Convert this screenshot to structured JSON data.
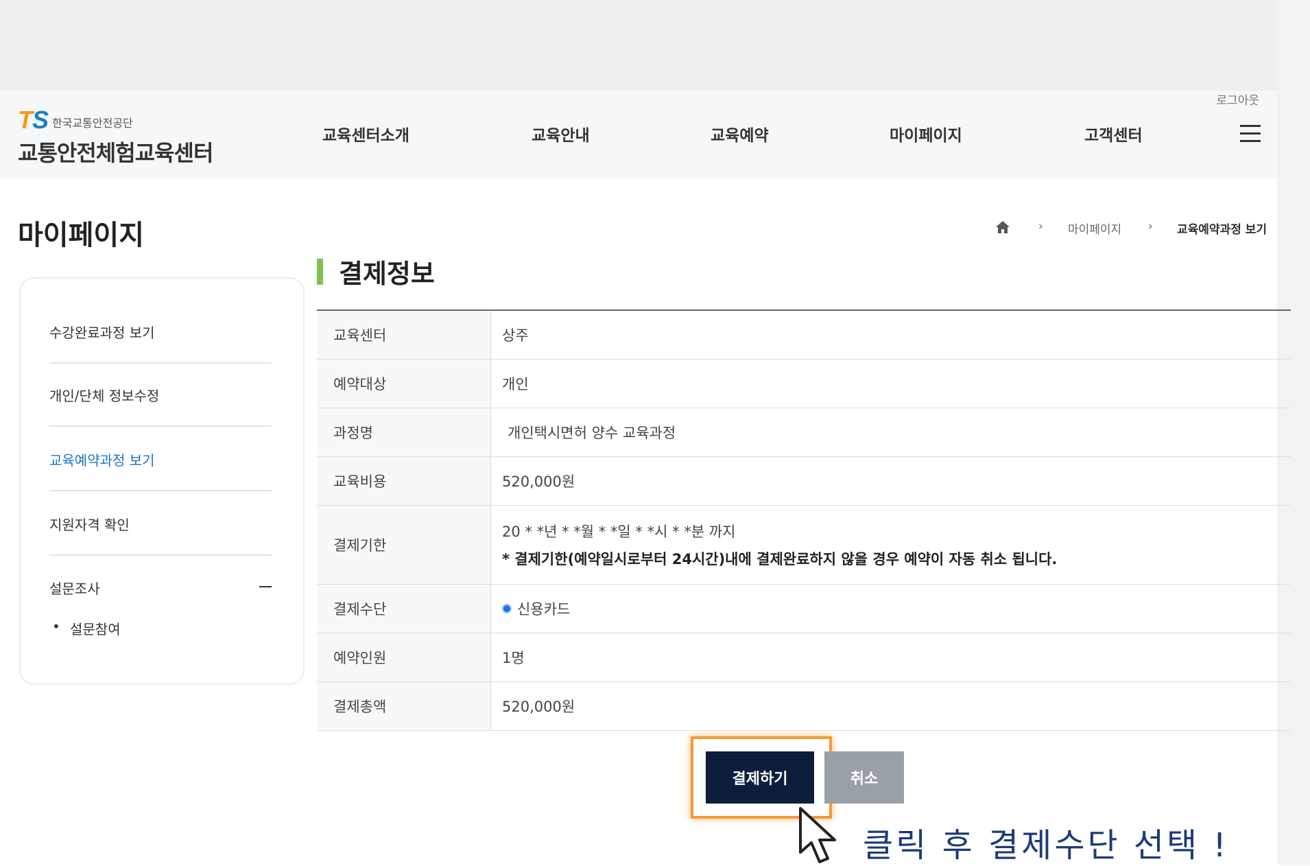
{
  "header": {
    "logout": "로그아웃",
    "logo_ts": "TS",
    "logo_sub": "한국교통안전공단",
    "logo_main": "교통안전체험교육센터",
    "nav": [
      "교육센터소개",
      "교육안내",
      "교육예약",
      "마이페이지",
      "고객센터"
    ],
    "menu_icon": "hamburger-icon"
  },
  "page": {
    "title": "마이페이지",
    "breadcrumb": [
      "마이페이지",
      "교육예약과정 보기"
    ]
  },
  "sidebar": {
    "items": [
      "수강완료과정 보기",
      "개인/단체 정보수정",
      "교육예약과정 보기",
      "지원자격 확인",
      "설문조사"
    ],
    "active": "교육예약과정 보기",
    "sub_items": [
      "설문참여"
    ]
  },
  "section": {
    "title": "결제정보"
  },
  "table": {
    "rows": [
      {
        "label": "교육센터",
        "value": "상주"
      },
      {
        "label": "예약대상",
        "value": "개인"
      },
      {
        "label": "과정명",
        "value": "개인택시면허 양수 교육과정"
      },
      {
        "label": "교육비용",
        "value": "520,000원"
      },
      {
        "label": "결제기한",
        "value": "20 * *년 * *월 * *일 * *시 * *분 까지",
        "note": "* 결제기한(예약일시로부터 24시간)내에 결제완료하지 않을 경우 예약이 자동 취소 됩니다."
      },
      {
        "label": "결제수단",
        "value": "신용카드"
      },
      {
        "label": "예약인원",
        "value": "1명"
      },
      {
        "label": "결제총액",
        "value": "520,000원"
      }
    ]
  },
  "buttons": {
    "pay": "결제하기",
    "cancel": "취소"
  },
  "hint": "클릭 후 결제수단 선택 !",
  "colors": {
    "accent_green": "#7cc24e",
    "active_blue": "#1a73c8",
    "pay_button": "#0d1e3d",
    "highlight_orange": "#f39a35",
    "hint_text": "#1c3b75"
  }
}
